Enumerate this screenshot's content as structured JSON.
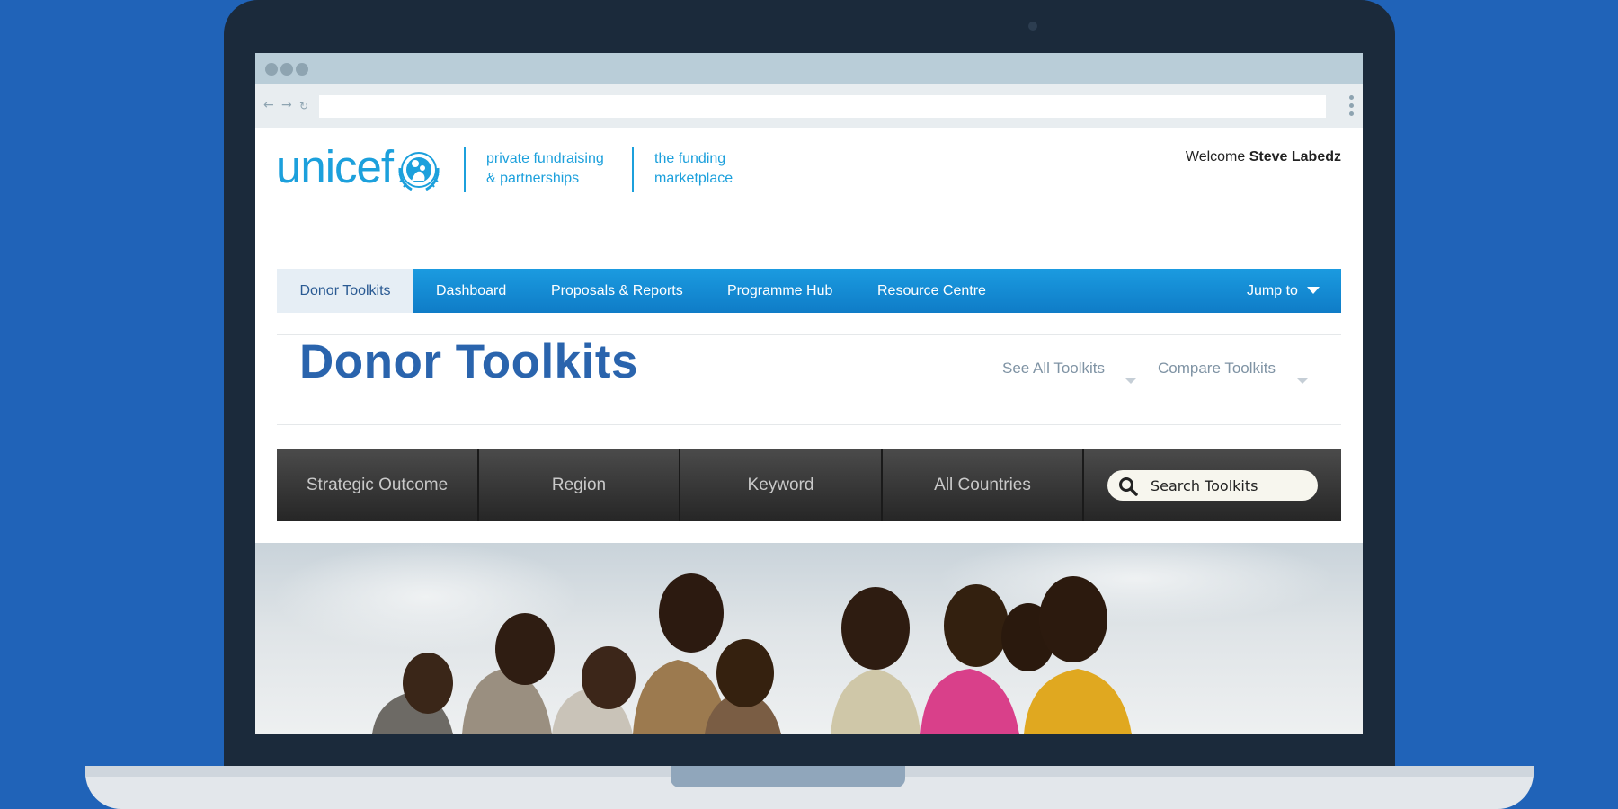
{
  "browser": {
    "url": "",
    "back_icon": "arrow-left-icon",
    "forward_icon": "arrow-right-icon",
    "reload_icon": "reload-icon",
    "menu_icon": "kebab-menu-icon"
  },
  "header": {
    "logo_text": "unicef",
    "logo_emblem": "un-emblem-icon",
    "tagline1": [
      "private fundraising",
      "& partnerships"
    ],
    "tagline2": [
      "the funding",
      "marketplace"
    ],
    "welcome_prefix": "Welcome",
    "user_name": "Steve Labedz"
  },
  "nav": {
    "items": [
      "Donor Toolkits",
      "Dashboard",
      "Proposals & Reports",
      "Programme Hub",
      "Resource Centre"
    ],
    "active": "Donor Toolkits",
    "jump_to": "Jump to"
  },
  "page": {
    "title": "Donor Toolkits",
    "see_all": "See All Toolkits",
    "compare": "Compare Toolkits"
  },
  "filters": {
    "items": [
      "Strategic Outcome",
      "Region",
      "Keyword",
      "All Countries"
    ],
    "search_placeholder": "Search Toolkits"
  },
  "colors": {
    "accent": "#1ca0dc",
    "title": "#2a64ad",
    "nav_bg": "#1585d1",
    "background": "#2063b8"
  }
}
